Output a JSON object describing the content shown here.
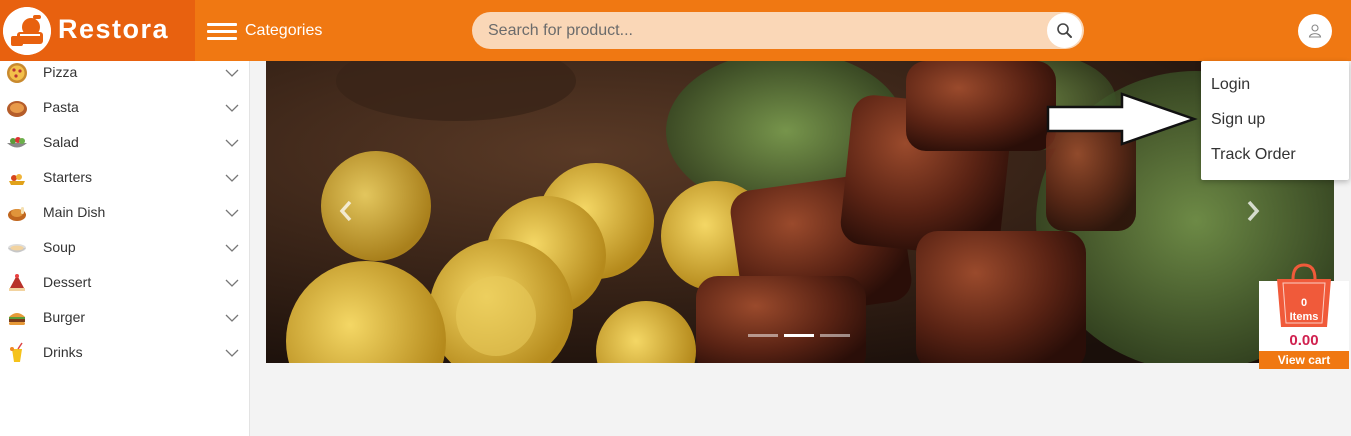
{
  "brand": {
    "name": "Restora",
    "accent": "#f07812",
    "accent_dark": "#e8610f"
  },
  "header": {
    "categories_label": "Categories",
    "search_placeholder": "Search for product..."
  },
  "sidebar": {
    "items": [
      {
        "label": "Pizza",
        "icon": "pizza-icon"
      },
      {
        "label": "Pasta",
        "icon": "pasta-icon"
      },
      {
        "label": "Salad",
        "icon": "salad-icon"
      },
      {
        "label": "Starters",
        "icon": "starters-icon"
      },
      {
        "label": "Main Dish",
        "icon": "main-dish-icon"
      },
      {
        "label": "Soup",
        "icon": "soup-icon"
      },
      {
        "label": "Dessert",
        "icon": "dessert-icon"
      },
      {
        "label": "Burger",
        "icon": "burger-icon"
      },
      {
        "label": "Drinks",
        "icon": "drinks-icon"
      }
    ]
  },
  "carousel": {
    "slide_count": 3,
    "active_slide": 2
  },
  "user_menu": {
    "items": [
      {
        "label": "Login"
      },
      {
        "label": "Sign up"
      },
      {
        "label": "Track Order"
      }
    ]
  },
  "cart": {
    "count": "0",
    "items_label": "Items",
    "total": "0.00",
    "view_label": "View cart",
    "total_color": "#d0214f"
  }
}
